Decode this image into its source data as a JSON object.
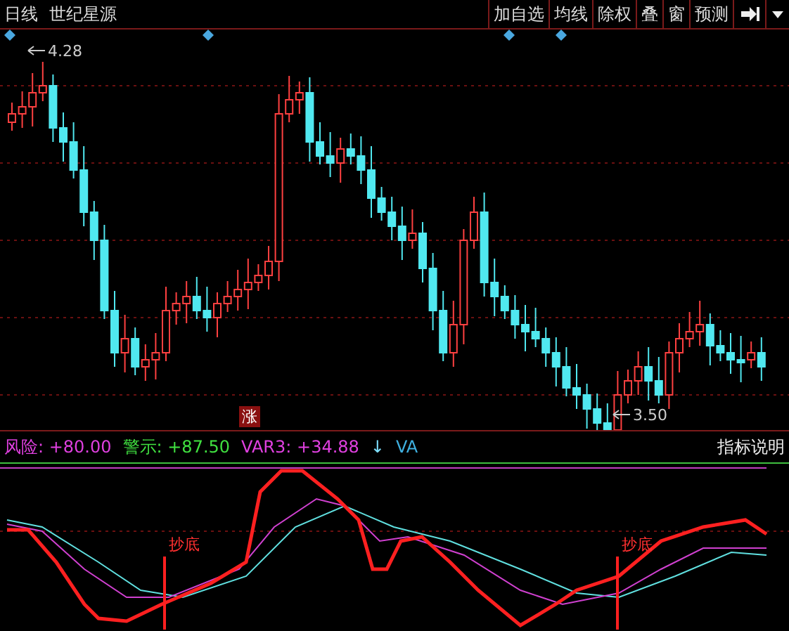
{
  "header": {
    "period": "日线",
    "stock_name": "世纪星源"
  },
  "toolbar": [
    {
      "label": "加自选"
    },
    {
      "label": "均线"
    },
    {
      "label": "除权"
    },
    {
      "label": "叠"
    },
    {
      "label": "窗"
    },
    {
      "label": "预测"
    }
  ],
  "price_chart": {
    "high_label": "4.28",
    "low_label": "3.50",
    "badge": "涨"
  },
  "indicator": {
    "readings": [
      {
        "label": "风险: +80.00",
        "color": "#e040e0"
      },
      {
        "label": "警示: +87.50",
        "color": "#40e040"
      },
      {
        "label": "VAR3: +34.88",
        "color": "#e040e0"
      }
    ],
    "arrow": "↓",
    "tag": "VA",
    "explain": "指标说明",
    "signals": [
      {
        "label": "抄底"
      },
      {
        "label": "抄底"
      }
    ]
  }
}
